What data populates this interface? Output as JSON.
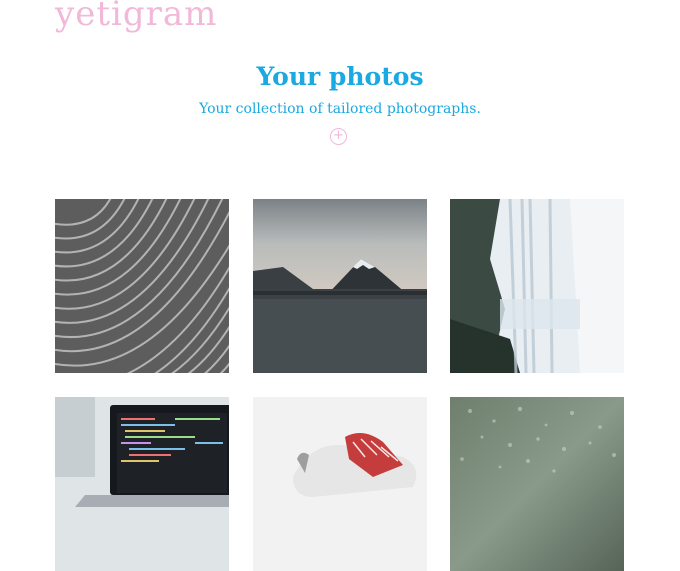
{
  "brand": {
    "logo_text": "yetigram"
  },
  "hero": {
    "title": "Your photos",
    "subtitle": "Your collection of tailored photographs.",
    "add_icon": "plus-circle-icon"
  },
  "photos": [
    {
      "subject": "abstract-waves"
    },
    {
      "subject": "mountain-lake"
    },
    {
      "subject": "waterfall"
    },
    {
      "subject": "laptop-code"
    },
    {
      "subject": "red-sneaker"
    },
    {
      "subject": "rainy-glass"
    }
  ],
  "colors": {
    "accent": "#1aa9e0",
    "brand": "#f2b8d8"
  }
}
